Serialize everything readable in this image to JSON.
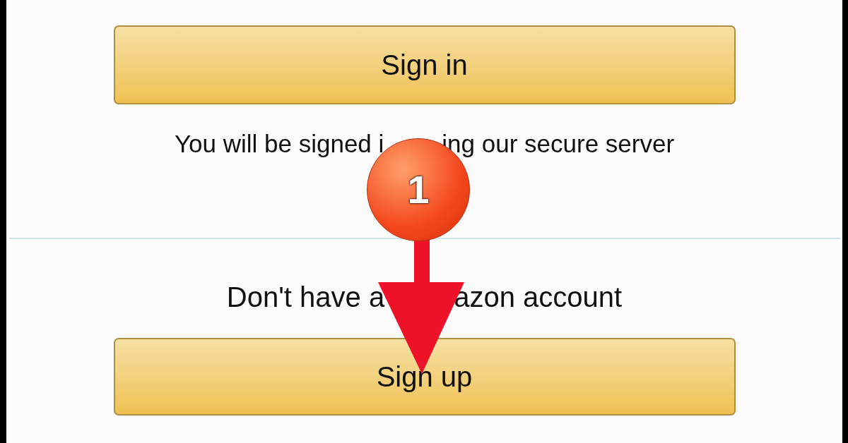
{
  "sign_in_button": {
    "label": "Sign in"
  },
  "secure_note": {
    "parts": [
      "You will be signed i",
      "ing our secure server"
    ]
  },
  "new_customer_prompt": {
    "parts": [
      "Don't have a",
      "azon account"
    ]
  },
  "sign_up_button": {
    "label": "Sign up"
  },
  "annotation": {
    "step": "1"
  }
}
